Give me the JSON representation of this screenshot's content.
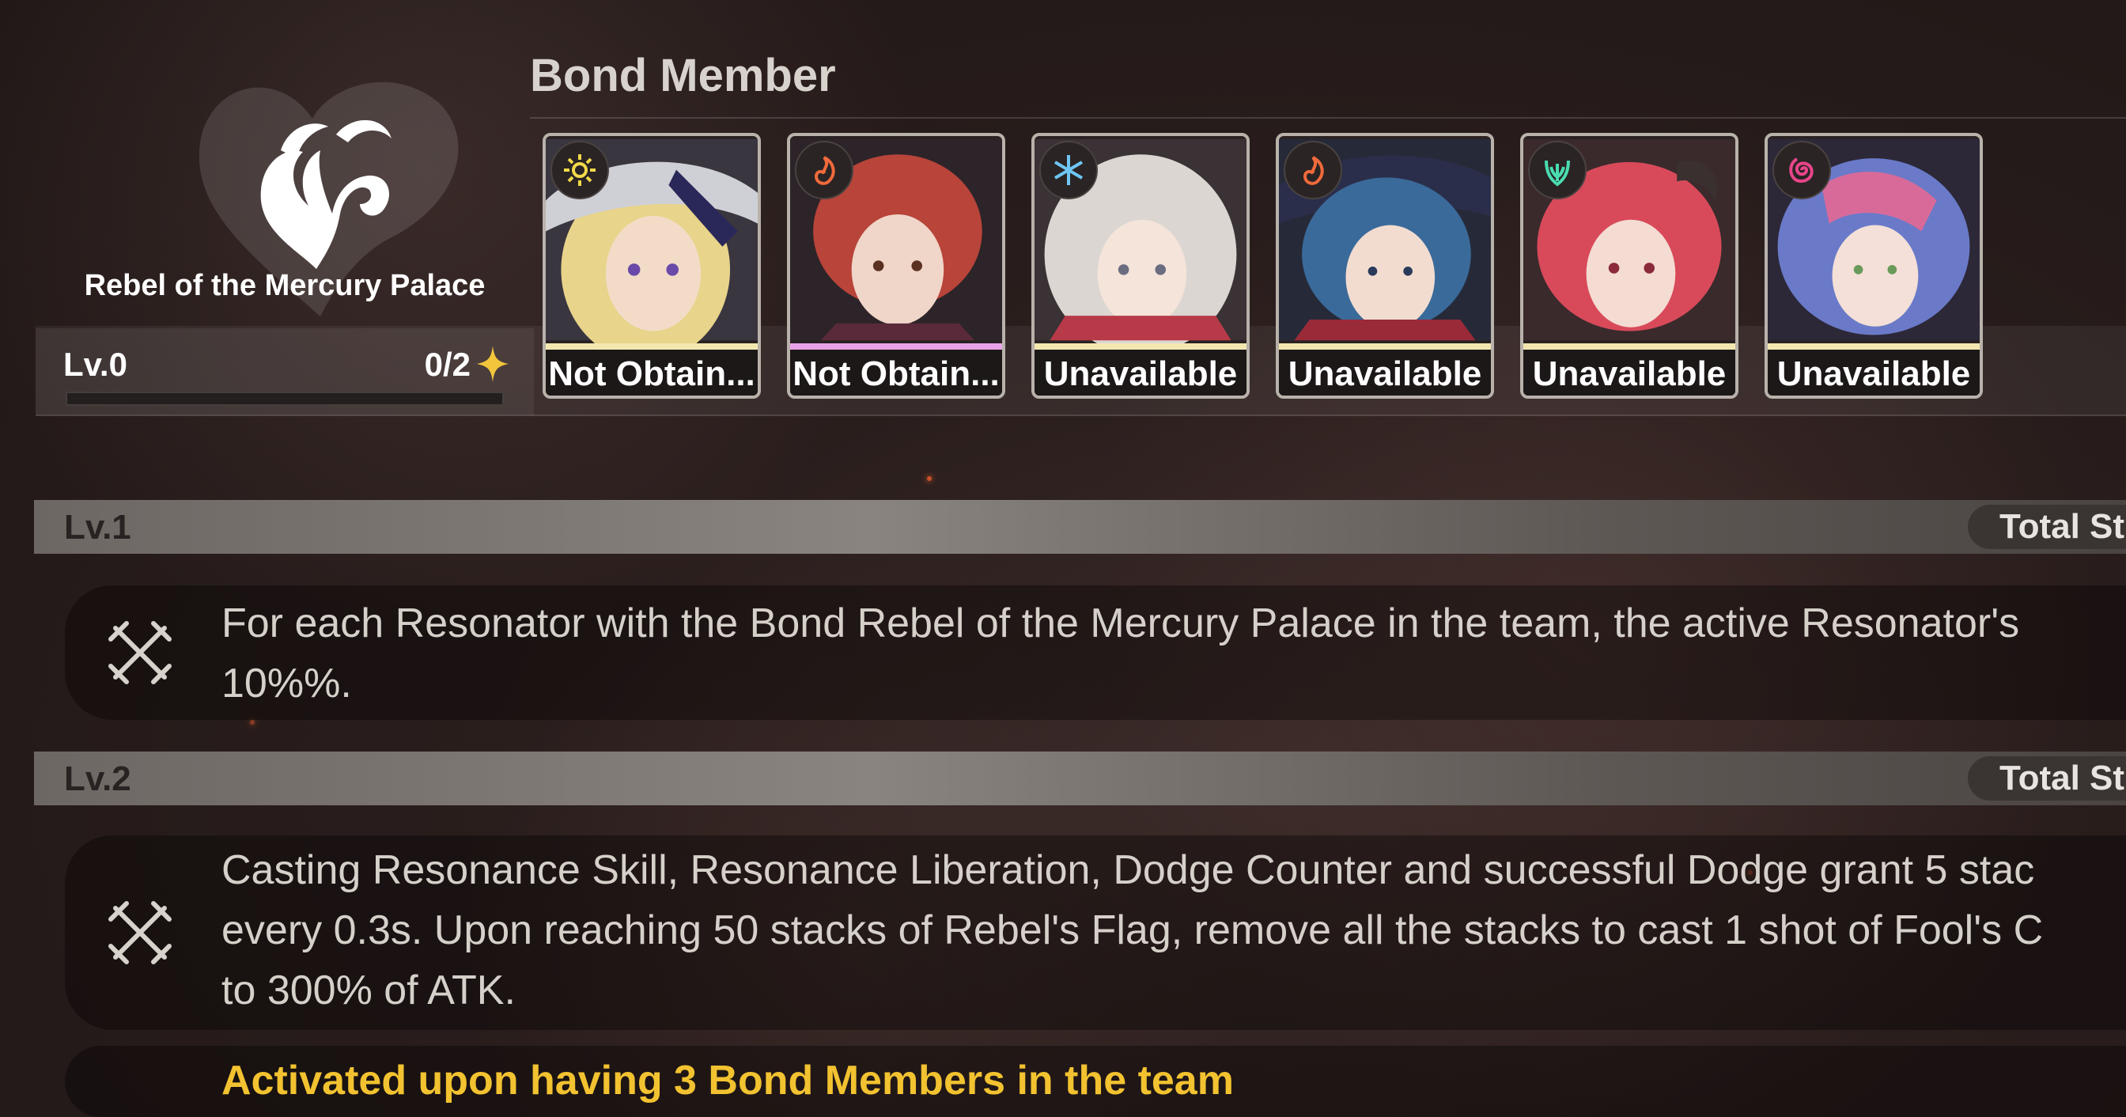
{
  "bond": {
    "name": "Rebel of the Mercury Palace",
    "level": "Lv.0",
    "progress": "0/2",
    "progress_fraction": 0
  },
  "members": {
    "title": "Bond Member",
    "cards": [
      {
        "label": "Not Obtain...",
        "element": "spectro-icon",
        "element_color": "#f2d94a",
        "strip_color": "#f3e7b0"
      },
      {
        "label": "Not Obtain...",
        "element": "fusion-icon",
        "element_color": "#f06a3c",
        "strip_color": "#e8a3e6"
      },
      {
        "label": "Unavailable",
        "element": "glacio-icon",
        "element_color": "#6ec6f2",
        "strip_color": "#f3e7b0"
      },
      {
        "label": "Unavailable",
        "element": "fusion-icon",
        "element_color": "#f06a3c",
        "strip_color": "#f3e7b0"
      },
      {
        "label": "Unavailable",
        "element": "aero-icon",
        "element_color": "#4adcb0",
        "strip_color": "#f3e7b0"
      },
      {
        "label": "Unavailable",
        "element": "havoc-icon",
        "element_color": "#e8458a",
        "strip_color": "#f3e7b0"
      }
    ]
  },
  "levels": [
    {
      "label": "Lv.1",
      "total_stat": "Total St",
      "effect_lines": [
        "For each Resonator with the Bond Rebel of the Mercury Palace in the team, the active Resonator's",
        "10%%."
      ]
    },
    {
      "label": "Lv.2",
      "total_stat": "Total St",
      "effect_lines": [
        "Casting Resonance Skill, Resonance Liberation, Dodge Counter and successful Dodge grant 5 stac",
        "every 0.3s. Upon reaching 50 stacks of Rebel's Flag, remove all the stacks to cast 1 shot of Fool's C",
        "to 300% of ATK."
      ],
      "activation": "Activated upon having 3 Bond Members in the team"
    }
  ],
  "colors": {
    "activated_text": "#f2c230",
    "header_bar": "#8a8480"
  }
}
